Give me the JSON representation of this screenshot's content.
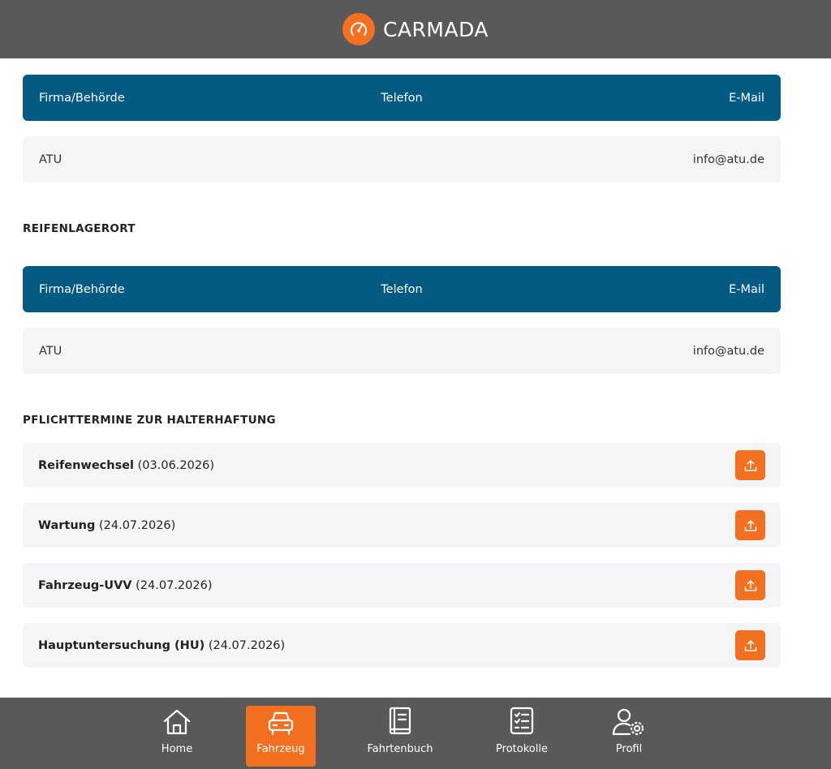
{
  "header": {
    "title": "CARMADA",
    "logo_icon": "speedometer-icon"
  },
  "colors": {
    "header_bg": "#595959",
    "accent": "#f37021",
    "table_head": "#055a84",
    "row_bg": "#f4f5f7"
  },
  "tables": [
    {
      "headers": {
        "company": "Firma/Behörde",
        "phone": "Telefon",
        "email": "E-Mail"
      },
      "row": {
        "company": "ATU",
        "phone": "",
        "email": "info@atu.de"
      }
    },
    {
      "headers": {
        "company": "Firma/Behörde",
        "phone": "Telefon",
        "email": "E-Mail"
      },
      "row": {
        "company": "ATU",
        "phone": "",
        "email": "info@atu.de"
      }
    }
  ],
  "sections": {
    "tire_storage": "REIFENLAGERORT",
    "mandatory": "PFLICHTTERMINE ZUR HALTERHAFTUNG"
  },
  "duties": [
    {
      "name": "Reifenwechsel",
      "date": "(03.06.2026)",
      "icon": "upload-icon"
    },
    {
      "name": "Wartung",
      "date": "(24.07.2026)",
      "icon": "upload-icon"
    },
    {
      "name": "Fahrzeug-UVV",
      "date": "(24.07.2026)",
      "icon": "upload-icon"
    },
    {
      "name": "Hauptuntersuchung (HU)",
      "date": "(24.07.2026)",
      "icon": "upload-icon"
    }
  ],
  "nav": [
    {
      "label": "Home",
      "icon": "home-icon",
      "active": false
    },
    {
      "label": "Fahrzeug",
      "icon": "car-icon",
      "active": true
    },
    {
      "label": "Fahrtenbuch",
      "icon": "book-icon",
      "active": false
    },
    {
      "label": "Protokolle",
      "icon": "checklist-icon",
      "active": false
    },
    {
      "label": "Profil",
      "icon": "user-settings-icon",
      "active": false
    }
  ]
}
